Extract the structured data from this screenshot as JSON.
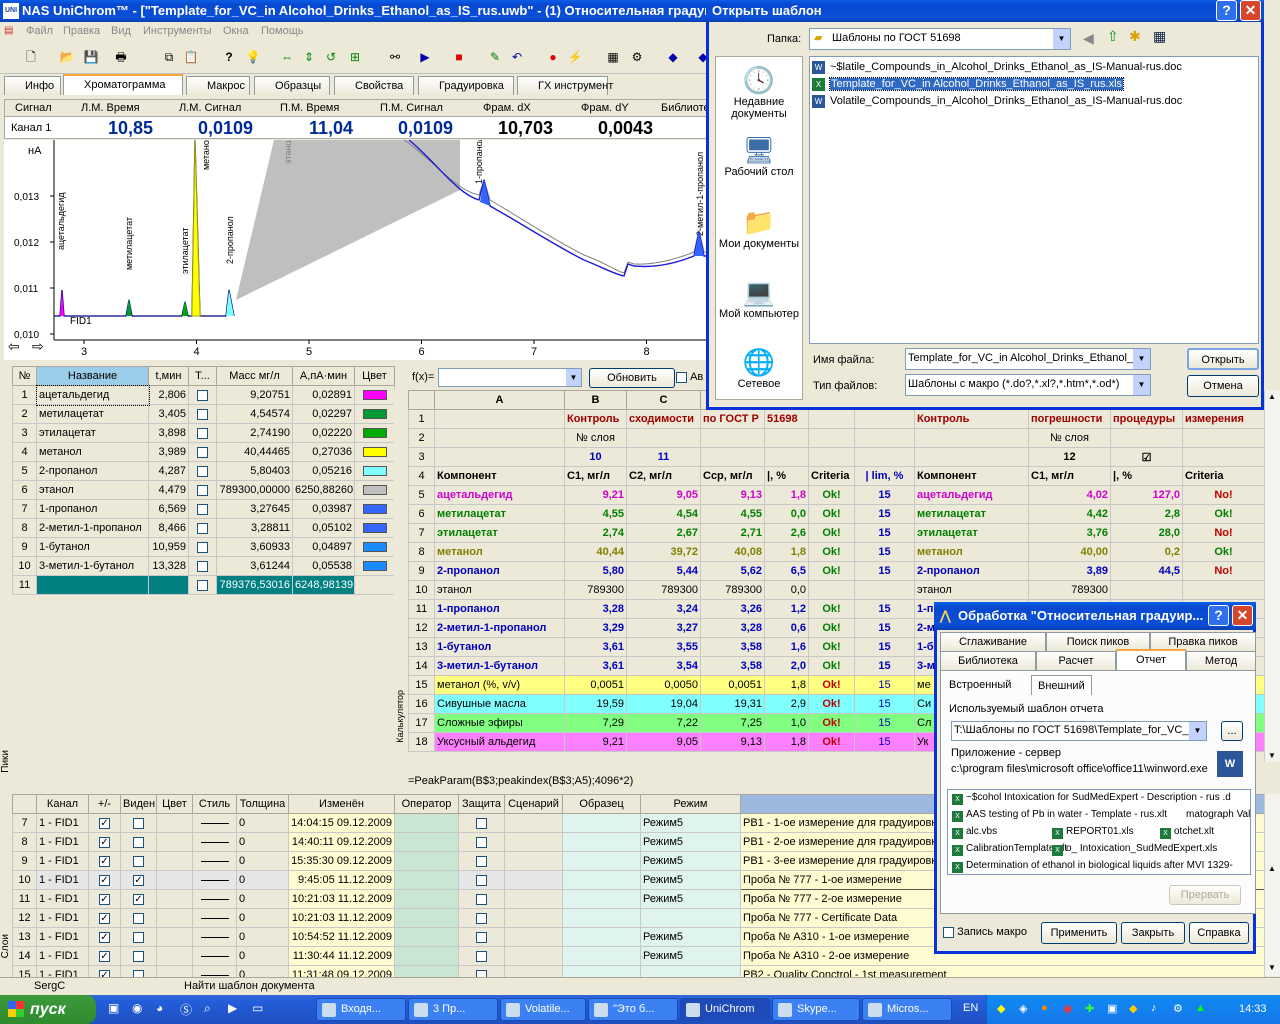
{
  "app": {
    "title": "NAS UniChrom™ - [\"Template_for_VC_in Alcohol_Drinks_Ethanol_as_IS_rus.uwb\" - (1) Относительная градуир"
  },
  "menu": [
    "Файл",
    "Правка",
    "Вид",
    "Инструменты",
    "Окна",
    "Помощь"
  ],
  "tabs": [
    "Инфо",
    "Хроматограмма",
    "Макрос",
    "Образцы",
    "Свойства",
    "Градуировка",
    "ГХ инструмент"
  ],
  "cursor": {
    "headers": [
      "Сигнал",
      "Л.М. Время",
      "Л.М. Сигнал",
      "П.М. Время",
      "П.М. Сигнал",
      "Фрам. dX",
      "Фрам. dY",
      "Библиоте"
    ],
    "channel": "Канал 1",
    "values": [
      "10,85",
      "0,0109",
      "11,04",
      "0,0109",
      "10,703",
      "0,0043"
    ]
  },
  "chart_data": {
    "type": "line",
    "ylabel": "нА",
    "yticks": [
      "0,013",
      "0,012",
      "0,011",
      "0,010"
    ],
    "xticks": [
      "3",
      "4",
      "5",
      "6",
      "7",
      "8"
    ],
    "trace_label": "FID1",
    "peaks": [
      {
        "name": "ацетальдегид",
        "x": 2.806
      },
      {
        "name": "метилацетат",
        "x": 3.405
      },
      {
        "name": "этилацетат",
        "x": 3.898
      },
      {
        "name": "метанол",
        "x": 3.989
      },
      {
        "name": "2-пропанол",
        "x": 4.287
      },
      {
        "name": "этанол",
        "x": 4.479
      },
      {
        "name": "1-пропанол",
        "x": 6.569
      },
      {
        "name": "2-метил-1-пропанол",
        "x": 8.466
      }
    ]
  },
  "peaks_table": {
    "headers": [
      "№",
      "Название",
      "t,мин",
      "Т...",
      "Масс мг/л",
      "А,пА·мин",
      "Цвет"
    ],
    "rows": [
      [
        "1",
        "ацетальдегид",
        "2,806",
        "9,20751",
        "0,02891",
        "#ff00ff"
      ],
      [
        "2",
        "метилацетат",
        "3,405",
        "4,54574",
        "0,02297",
        "#009933"
      ],
      [
        "3",
        "этилацетат",
        "3,898",
        "2,74190",
        "0,02220",
        "#00aa00"
      ],
      [
        "4",
        "метанол",
        "3,989",
        "40,44465",
        "0,27036",
        "#ffff00"
      ],
      [
        "5",
        "2-пропанол",
        "4,287",
        "5,80403",
        "0,05216",
        "#80ffff"
      ],
      [
        "6",
        "этанол",
        "4,479",
        "789300,00000",
        "6250,88260",
        "#c0c0c0"
      ],
      [
        "7",
        "1-пропанол",
        "6,569",
        "3,27645",
        "0,03987",
        "#3366ff"
      ],
      [
        "8",
        "2-метил-1-пропанол",
        "8,466",
        "3,28811",
        "0,05102",
        "#3366ff"
      ],
      [
        "9",
        "1-бутанол",
        "10,959",
        "3,60933",
        "0,04897",
        "#1a8cff"
      ],
      [
        "10",
        "3-метил-1-бутанол",
        "13,328",
        "3,61244",
        "0,05538",
        "#1a8cff"
      ],
      [
        "11",
        "",
        "",
        "789376,53016",
        "6248,98139",
        ""
      ]
    ]
  },
  "side_labels": {
    "peaks": "Пики",
    "layers": "Слои",
    "calc": "Калькулятор"
  },
  "fx": {
    "label": "f(x)=",
    "button": "Обновить",
    "checkbox_label": "Ав",
    "formula": "=PeakParam(B$3;peakindex(B$3;A5);4096*2)"
  },
  "sheet": {
    "cols": [
      "A",
      "B",
      "C",
      "D"
    ],
    "rows": [
      {
        "n": "1",
        "c": [
          "",
          "Контроль",
          "сходимости",
          "по ГОСТ Р",
          "51698",
          "",
          "",
          "Контроль",
          "погрешности",
          "процедуры",
          "измерения"
        ]
      },
      {
        "n": "2",
        "c": [
          "",
          "№ слоя",
          "",
          "",
          "",
          "",
          "",
          "",
          "№ слоя",
          "",
          ""
        ]
      },
      {
        "n": "3",
        "c": [
          "",
          "10",
          "11",
          "",
          "",
          "",
          "",
          "",
          "12",
          "☑",
          ""
        ]
      },
      {
        "n": "4",
        "c": [
          "Компонент",
          "C1, мг/л",
          "C2, мг/л",
          "Cср, мг/л",
          "|, %",
          "Criteria",
          "| lim, %",
          "Компонент",
          "C1, мг/л",
          "|, %",
          "Criteria"
        ]
      },
      {
        "n": "5",
        "c": [
          "ацетальдегид",
          "9,21",
          "9,05",
          "9,13",
          "1,8",
          "Ok!",
          "15",
          "ацетальдегид",
          "4,02",
          "127,0",
          "No!"
        ]
      },
      {
        "n": "6",
        "c": [
          "метилацетат",
          "4,55",
          "4,54",
          "4,55",
          "0,0",
          "Ok!",
          "15",
          "метилацетат",
          "4,42",
          "2,8",
          "Ok!"
        ]
      },
      {
        "n": "7",
        "c": [
          "этилацетат",
          "2,74",
          "2,67",
          "2,71",
          "2,6",
          "Ok!",
          "15",
          "этилацетат",
          "3,76",
          "28,0",
          "No!"
        ]
      },
      {
        "n": "8",
        "c": [
          "метанол",
          "40,44",
          "39,72",
          "40,08",
          "1,8",
          "Ok!",
          "15",
          "метанол",
          "40,00",
          "0,2",
          "Ok!"
        ]
      },
      {
        "n": "9",
        "c": [
          "2-пропанол",
          "5,80",
          "5,44",
          "5,62",
          "6,5",
          "Ok!",
          "15",
          "2-пропанол",
          "3,89",
          "44,5",
          "No!"
        ]
      },
      {
        "n": "10",
        "c": [
          "этанол",
          "789300",
          "789300",
          "789300",
          "0,0",
          "",
          "",
          "этанол",
          "789300",
          "",
          ""
        ]
      },
      {
        "n": "11",
        "c": [
          "1-пропанол",
          "3,28",
          "3,24",
          "3,26",
          "1,2",
          "Ok!",
          "15",
          "1-п",
          "",
          "",
          ""
        ]
      },
      {
        "n": "12",
        "c": [
          "2-метил-1-пропанол",
          "3,29",
          "3,27",
          "3,28",
          "0,6",
          "Ok!",
          "15",
          "2-м",
          "",
          "",
          ""
        ]
      },
      {
        "n": "13",
        "c": [
          "1-бутанол",
          "3,61",
          "3,55",
          "3,58",
          "1,6",
          "Ok!",
          "15",
          "1-б",
          "",
          "",
          ""
        ]
      },
      {
        "n": "14",
        "c": [
          "3-метил-1-бутанол",
          "3,61",
          "3,54",
          "3,58",
          "2,0",
          "Ok!",
          "15",
          "3-м",
          "",
          "",
          ""
        ]
      },
      {
        "n": "15",
        "c": [
          "метанол (%, v/v)",
          "0,0051",
          "0,0050",
          "0,0051",
          "1,8",
          "Ok!",
          "15",
          "ме",
          "",
          "",
          ""
        ]
      },
      {
        "n": "16",
        "c": [
          "Сивушные масла",
          "19,59",
          "19,04",
          "19,31",
          "2,9",
          "Ok!",
          "15",
          "Си",
          "",
          "",
          ""
        ]
      },
      {
        "n": "17",
        "c": [
          "Сложные эфиры",
          "7,29",
          "7,22",
          "7,25",
          "1,0",
          "Ok!",
          "15",
          "Сл",
          "",
          "",
          ""
        ]
      },
      {
        "n": "18",
        "c": [
          "Уксусный альдегид",
          "9,21",
          "9,05",
          "9,13",
          "1,8",
          "Ok!",
          "15",
          "Ук",
          "",
          "",
          ""
        ]
      }
    ]
  },
  "layers": {
    "headers": [
      "Канал",
      "+/-",
      "Виден",
      "Цвет",
      "Стиль",
      "Толщина",
      "Изменён",
      "Оператор",
      "Защита",
      "Сценарий",
      "Образец",
      "Режим",
      ""
    ],
    "rows": [
      {
        "n": "7",
        "ch": "1 - FID1",
        "v": false,
        "t": "0",
        "d": "14:04:15 09.12.2009",
        "mode": "Режим5",
        "desc": "РВ1 - 1-ое измерение для градуировки"
      },
      {
        "n": "8",
        "ch": "1 - FID1",
        "v": false,
        "t": "0",
        "d": "14:40:11 09.12.2009",
        "mode": "Режим5",
        "desc": "РВ1 - 2-ое измерение для градуировки"
      },
      {
        "n": "9",
        "ch": "1 - FID1",
        "v": false,
        "t": "0",
        "d": "15:35:30 09.12.2009",
        "mode": "Режим5",
        "desc": "РВ1 - 3-ее измерение для градуировки"
      },
      {
        "n": "10",
        "ch": "1 - FID1",
        "v": true,
        "t": "0",
        "d": "9:45:05 11.12.2009",
        "mode": "Режим5",
        "desc": "Проба № 777 - 1-ое измерение"
      },
      {
        "n": "11",
        "ch": "1 - FID1",
        "v": true,
        "t": "0",
        "d": "10:21:03 11.12.2009",
        "mode": "Режим5",
        "desc": "Проба № 777 - 2-ое измерение"
      },
      {
        "n": "12",
        "ch": "1 - FID1",
        "v": false,
        "t": "0",
        "d": "10:21:03 11.12.2009",
        "mode": "",
        "desc": "Проба № 777 - Certificate Data"
      },
      {
        "n": "13",
        "ch": "1 - FID1",
        "v": false,
        "t": "0",
        "d": "10:54:52 11.12.2009",
        "mode": "Режим5",
        "desc": "Проба № А310 - 1-ое измерение"
      },
      {
        "n": "14",
        "ch": "1 - FID1",
        "v": false,
        "t": "0",
        "d": "11:30:44 11.12.2009",
        "mode": "Режим5",
        "desc": "Проба № А310 - 2-ое измерение"
      },
      {
        "n": "15",
        "ch": "1 - FID1",
        "v": false,
        "t": "0",
        "d": "11:31:48 09.12.2009",
        "mode": "",
        "desc": "РВ2 - Quality Conctrol - 1st measurement"
      }
    ]
  },
  "status": {
    "user": "SergC",
    "msg": "Найти шаблон документа"
  },
  "open_dialog": {
    "title": "Открыть шаблон",
    "folder_label": "Папка:",
    "folder": "Шаблоны по ГОСТ 51698",
    "places": [
      "Недавние документы",
      "Рабочий стол",
      "Мои документы",
      "Мой компьютер",
      "Сетевое"
    ],
    "files": [
      "~$latile_Compounds_in_Alcohol_Drinks_Ethanol_as_IS-Manual-rus.doc",
      "Template_for_VC_in Alcohol_Drinks_Ethanol_as_IS_rus.xls",
      "Volatile_Compounds_in_Alcohol_Drinks_Ethanol_as_IS-Manual-rus.doc"
    ],
    "filename_label": "Имя файла:",
    "filename": "Template_for_VC_in Alcohol_Drinks_Ethanol_a",
    "filetype_label": "Тип файлов:",
    "filetype": "Шаблоны с макро (*.do?,*.xl?,*.htm*,*.od*)",
    "open": "Открыть",
    "cancel": "Отмена"
  },
  "proc_dialog": {
    "title": "Обработка \"Относительная градуир...",
    "tabs_row1": [
      "Сглаживание",
      "Поиск пиков",
      "Правка пиков"
    ],
    "tabs_row2": [
      "Библиотека",
      "Расчет",
      "Отчет",
      "Метод"
    ],
    "subtabs": [
      "Встроенный",
      "Внешний"
    ],
    "template_label": "Используемый шаблон отчета",
    "template_path": "T:\\Шаблоны по ГОСТ 51698\\Template_for_VC_i",
    "browse": "...",
    "app_label": "Приложение - сервер",
    "app_path": "c:\\program files\\microsoft office\\office11\\winword.exe",
    "files": [
      "~$cohol Intoxication for SudMedExpert - Description - rus .d",
      "AAS testing of Pb in water - Template - rus.xlt",
      "matograph Val",
      "alc.vbs",
      "REPORT01.xls",
      "otchet.xlt",
      "CalibrationTemplate.xlt",
      "o_ Intoxication_SudMedExpert.xls",
      "Determination of ethanol in biological liquids after MVI 1329-"
    ],
    "interrupt": "Прервать",
    "macro": "Запись макро",
    "apply": "Применить",
    "close": "Закрыть",
    "help": "Справка"
  },
  "taskbar": {
    "start": "пуск",
    "items": [
      "Входя...",
      "3 Пр...",
      "Volatile...",
      "\"Это б...",
      "UniChrom",
      "Skype...",
      "Micros..."
    ],
    "lang": "EN",
    "clock": "14:33"
  }
}
